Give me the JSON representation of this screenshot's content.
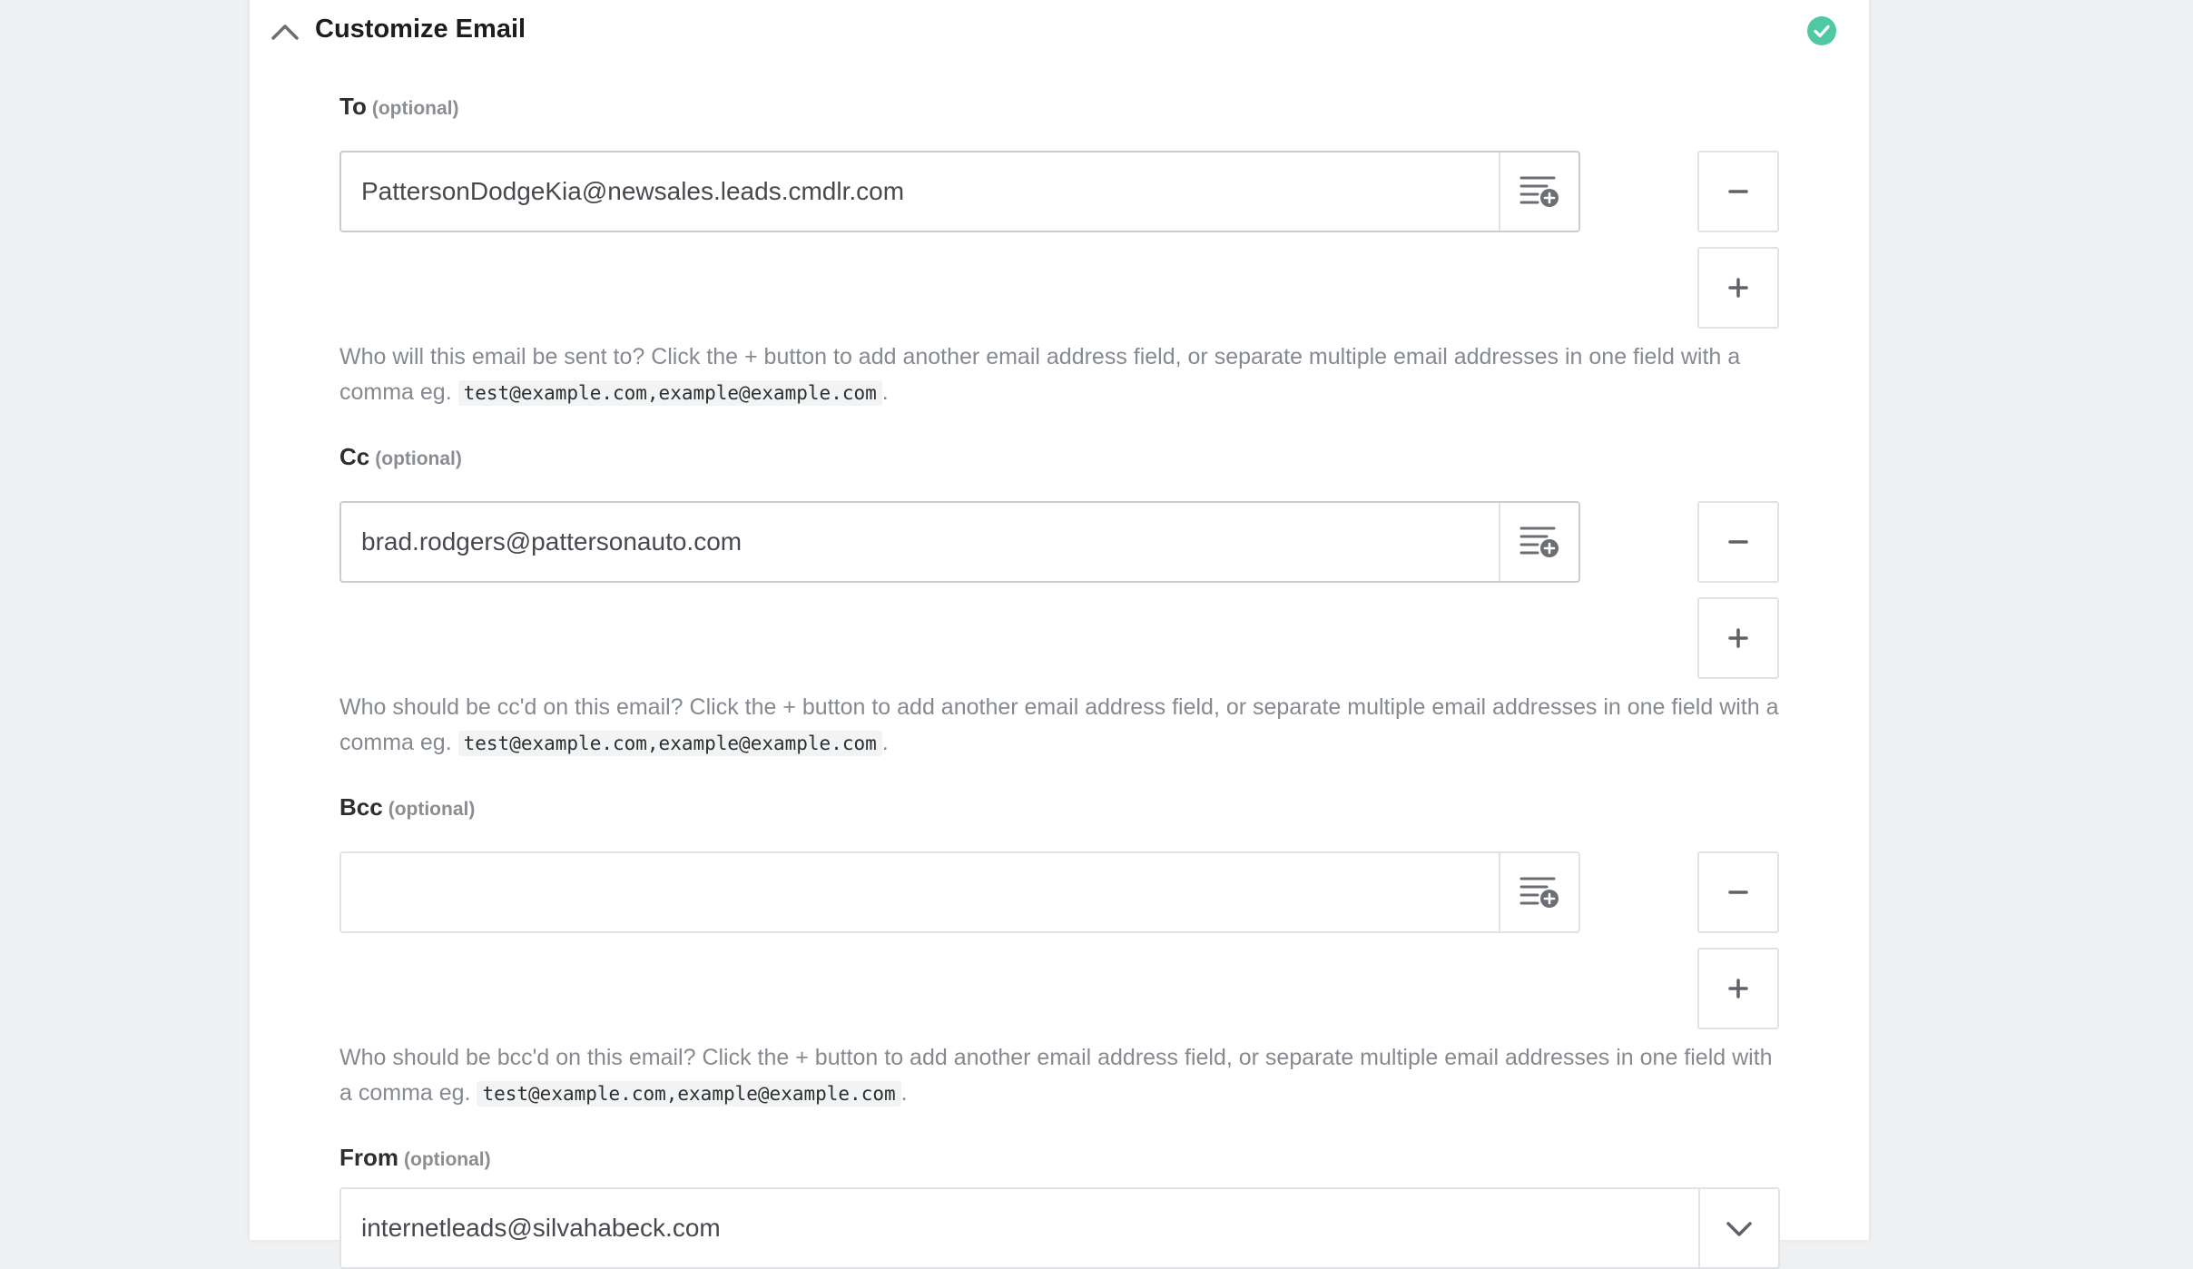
{
  "section": {
    "title": "Customize Email",
    "collapse_icon": "chevron-up-icon",
    "status_icon": "check-circle-icon",
    "status_color": "#4fc8a3"
  },
  "optional_label": "(optional)",
  "fields": {
    "to": {
      "label": "To",
      "value": "PattersonDodgeKia@newsales.leads.cmdlr.com",
      "help_text": "Who will this email be sent to? Click the + button to add another email address field, or separate multiple email addresses in one field with a comma eg.",
      "help_code": "test@example.com,example@example.com",
      "help_end": "."
    },
    "cc": {
      "label": "Cc",
      "value": "brad.rodgers@pattersonauto.com",
      "help_text": "Who should be cc'd on this email? Click the + button to add another email address field, or separate multiple email addresses in one field with a comma eg.",
      "help_code": "test@example.com,example@example.com",
      "help_end": "."
    },
    "bcc": {
      "label": "Bcc",
      "value": "",
      "help_text": "Who should be bcc'd on this email? Click the + button to add another email address field, or separate multiple email addresses in one field with a comma eg.",
      "help_code": "test@example.com,example@example.com",
      "help_end": "."
    },
    "from": {
      "label": "From",
      "value": "internetleads@silvahabeck.com"
    }
  },
  "icons": {
    "insert_field": "insert-field-icon",
    "remove": "minus-icon",
    "add": "plus-icon",
    "dropdown": "chevron-down-icon"
  }
}
